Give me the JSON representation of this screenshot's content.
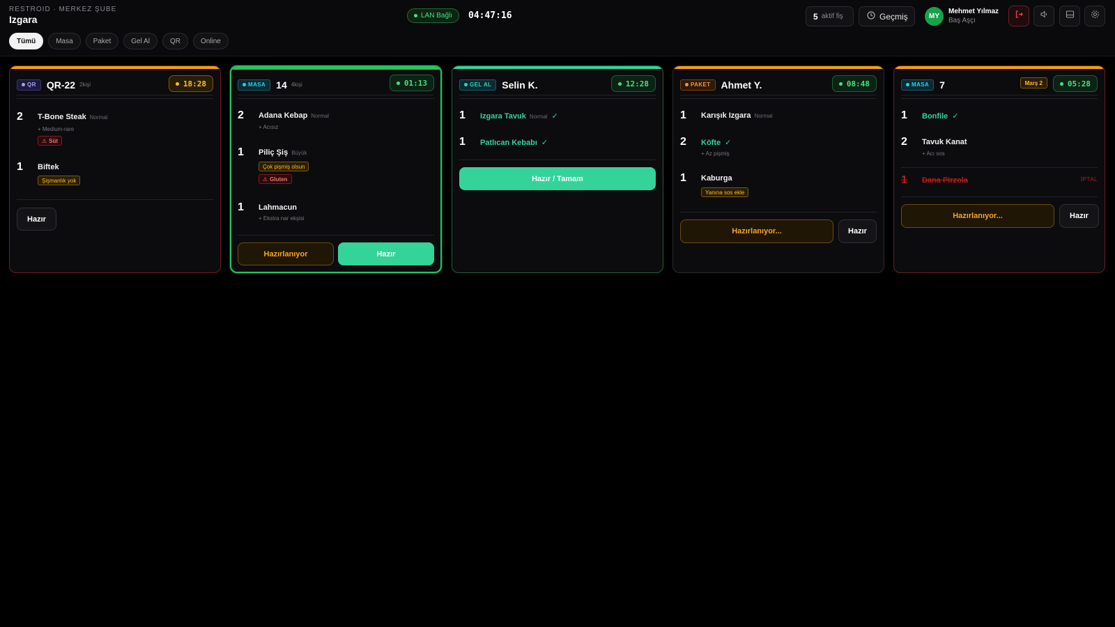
{
  "header": {
    "branch": "RESTROID · MERKEZ ŞUBE",
    "station": "Izgara",
    "lan_status": "LAN Bağlı",
    "clock": "04:47:16",
    "active_count": "5",
    "active_label": "aktif fiş",
    "history_label": "Geçmiş",
    "user": {
      "initials": "MY",
      "name": "Mehmet Yılmaz",
      "role": "Baş Aşçı"
    }
  },
  "filters": [
    "Tümü",
    "Masa",
    "Paket",
    "Gel Al",
    "QR",
    "Online"
  ],
  "active_filter": "Tümü",
  "colors": {
    "accent_green": "#34d399",
    "warning": "#f59e0b",
    "danger": "#dc2626",
    "bg": "#000000"
  },
  "orders": [
    {
      "type": "QR",
      "name": "QR-22",
      "guests": "2kişi",
      "timer": "18:28",
      "timer_state": "warning",
      "items": [
        {
          "qty": "1",
          "name": "",
          "size": ""
        }
      ],
      "lines": [
        {
          "qty": "2",
          "name": "T-Bone Steak",
          "size": "Normal",
          "modifier": "+ Medium-rare",
          "allergy": "Süt"
        },
        {
          "qty": "1",
          "name": "Biftek",
          "note": "Şişmanlık yok"
        }
      ],
      "actions": [
        "Hazır"
      ]
    },
    {
      "type": "MASA",
      "name": "14",
      "guests": "4kişi",
      "timer": "01:13",
      "timer_state": "ok",
      "lines": [
        {
          "qty": "2",
          "name": "Adana Kebap",
          "size": "Normal",
          "modifier": "+ Acısız"
        },
        {
          "qty": "1",
          "name": "Piliç Şiş",
          "size": "Büyük",
          "note": "Çok pişmiş olsun",
          "allergy": "Gluten"
        },
        {
          "qty": "1",
          "name": "Lahmacun",
          "modifier": "+ Ekstra nar ekşisi"
        }
      ],
      "actions": [
        "Hazırlanıyor",
        "Hazır"
      ]
    },
    {
      "type": "GEL AL",
      "name": "Selin K.",
      "timer": "12:28",
      "timer_state": "ok",
      "lines": [
        {
          "qty": "1",
          "name": "Izgara Tavuk",
          "size": "Normal",
          "done": "✓"
        },
        {
          "qty": "1",
          "name": "Patlıcan Kebabı",
          "done": "✓"
        }
      ],
      "actions": [
        "Hazır / Tamam"
      ]
    },
    {
      "type": "PAKET",
      "name": "Ahmet Y.",
      "timer": "08:48",
      "timer_state": "ok",
      "lines": [
        {
          "qty": "1",
          "name": "Karışık Izgara",
          "size": "Normal"
        },
        {
          "qty": "2",
          "name": "Köfte",
          "done": "✓",
          "modifier": "+ Az pişmiş"
        },
        {
          "qty": "1",
          "name": "Kaburga",
          "note": "Yanına sos ekle"
        }
      ],
      "actions": [
        "Hazırlanıyor...",
        "Hazır"
      ]
    },
    {
      "type": "MASA",
      "name": "7",
      "course": "Marş 2",
      "timer": "05:28",
      "timer_state": "ok",
      "lines": [
        {
          "qty": "1",
          "name": "Bonfile",
          "done": "✓"
        },
        {
          "qty": "2",
          "name": "Tavuk Kanat",
          "modifier": "+ Acı sos"
        },
        {
          "qty": "1",
          "name": "Dana Pirzola",
          "status": "İPTAL"
        }
      ],
      "actions": [
        "Hazırlanıyor...",
        "Hazır"
      ]
    }
  ],
  "icons": {
    "history": "clock-icon",
    "logout": "logout-icon",
    "sound": "speaker-icon",
    "display": "display-icon",
    "settings": "gear-icon",
    "allergy": "warning-icon"
  }
}
